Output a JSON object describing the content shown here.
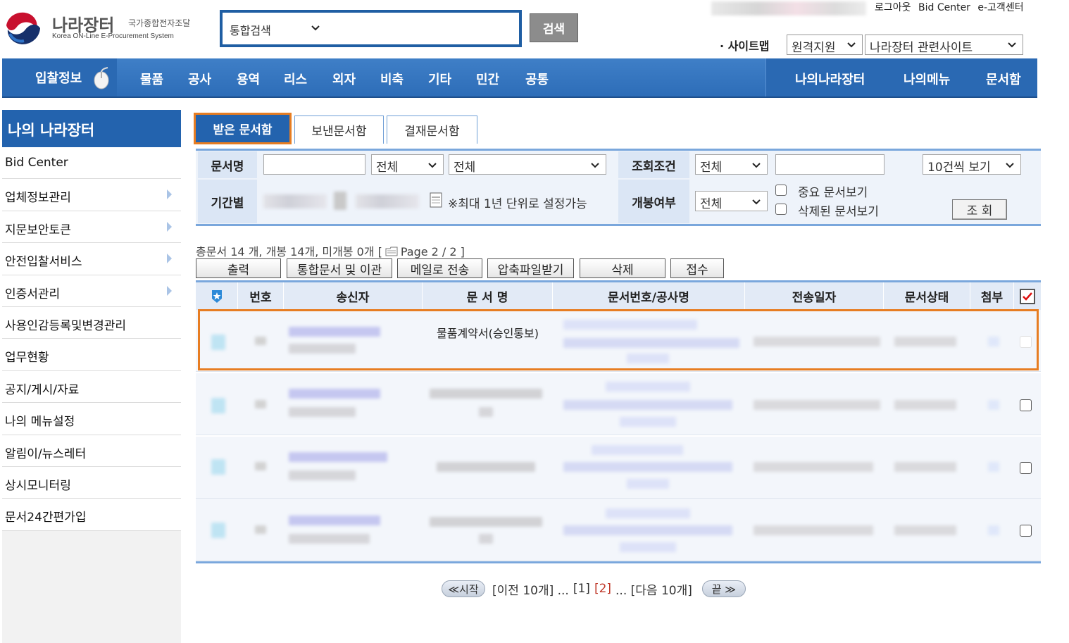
{
  "header": {
    "logo_title": "나라장터",
    "logo_sub": "국가종합전자조달",
    "logo_eng": "Korea ON-Line E-Procurement System",
    "search_select": "통합검색",
    "search_button": "검색",
    "top_links": [
      "로그아웃",
      "Bid Center",
      "e-고객센터"
    ],
    "sitemap": "· 사이트맵",
    "remote_select": "원격지원",
    "related_select": "나라장터 관련사이트"
  },
  "nav": {
    "bid_info": "입찰정보",
    "items": [
      "물품",
      "공사",
      "용역",
      "리스",
      "외자",
      "비축",
      "기타",
      "민간",
      "공통"
    ],
    "right_items": [
      "나의나라장터",
      "나의메뉴",
      "문서함"
    ]
  },
  "sidebar": {
    "title": "나의 나라장터",
    "items": [
      {
        "label": "Bid Center"
      },
      {
        "label": "업체정보관리"
      },
      {
        "label": "지문보안토큰"
      },
      {
        "label": "안전입찰서비스"
      },
      {
        "label": "인증서관리"
      },
      {
        "label": "사용인감등록및변경관리"
      },
      {
        "label": "업무현황"
      },
      {
        "label": "공지/게시/자료"
      },
      {
        "label": "나의 메뉴설정"
      },
      {
        "label": "알림이/뉴스레터"
      },
      {
        "label": "상시모니터링"
      },
      {
        "label": "문서24간편가입"
      }
    ]
  },
  "tabs": {
    "received": "받은 문서함",
    "sent": "보낸문서함",
    "approval": "결재문서함"
  },
  "filter": {
    "doc_name_label": "문서명",
    "doc_select_1": "전체",
    "doc_select_2": "전체",
    "condition_label": "조회조건",
    "condition_select": "전체",
    "page_size": "10건씩 보기",
    "period_label": "기간별",
    "period_note": "※최대 1년 단위로 설정가능",
    "opened_label": "개봉여부",
    "opened_select": "전체",
    "important_only": "중요 문서보기",
    "deleted_only": "삭제된 문서보기",
    "inquire_button": "조 회"
  },
  "summary": {
    "counts": "총문서 14 개, 개봉 14개, 미개봉 0개 [",
    "page": "Page 2 / 2 ]"
  },
  "actions": [
    "출력",
    "통합문서 및 이관",
    "메일로 전송",
    "압축파일받기",
    "삭제",
    "접수"
  ],
  "table": {
    "headers": [
      "번호",
      "송신자",
      "문 서 명",
      "문서번호/공사명",
      "전송일자",
      "문서상태",
      "첨부"
    ],
    "first_row_title": "물품계약서(승인통보)"
  },
  "pager": {
    "start": "≪시작",
    "prev": "[이전 10개] ...",
    "page1": "[1]",
    "page2": "[2]",
    "next": "... [다음 10개]",
    "end": "끝 ≫"
  },
  "colors": {
    "brand_blue": "#2363ae",
    "highlight_orange": "#e77d22",
    "border_blue": "#7aa7dc"
  }
}
